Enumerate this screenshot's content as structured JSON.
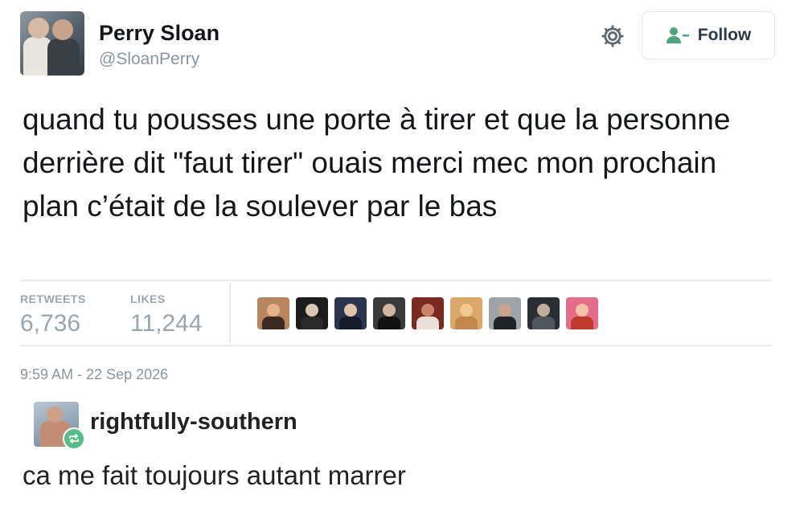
{
  "tweet": {
    "author_name": "Perry Sloan",
    "author_handle": "@SloanPerry",
    "follow_label": "Follow",
    "text": "quand tu pousses une porte à tirer et que la personne derrière dit \"faut tirer\" ouais merci mec mon prochain plan c’était de la soulever par le bas",
    "retweets_label": "RETWEETS",
    "retweets_count": "6,736",
    "likes_label": "LIKES",
    "likes_count": "11,244",
    "timestamp": "9:59 AM - 22 Sep 2026",
    "likers": [
      {
        "bg": "#b9855c",
        "face": "#e3b48c",
        "body": "#3b2a22"
      },
      {
        "bg": "#1c1c1c",
        "face": "#d9c7b6",
        "body": "#2a2a2a"
      },
      {
        "bg": "#2a3550",
        "face": "#e0c3a8",
        "body": "#151b2b"
      },
      {
        "bg": "#3a3a3a",
        "face": "#d1b7a2",
        "body": "#111111"
      },
      {
        "bg": "#7a2a20",
        "face": "#c9836a",
        "body": "#e8e0d8"
      },
      {
        "bg": "#d9a86a",
        "face": "#f1c98e",
        "body": "#c2874b"
      },
      {
        "bg": "#9ea3a8",
        "face": "#caa48d",
        "body": "#1f2428"
      },
      {
        "bg": "#2b2f33",
        "face": "#bfae9c",
        "body": "#50565c"
      },
      {
        "bg": "#e46b8a",
        "face": "#f2c3a6",
        "body": "#c0392b"
      }
    ]
  },
  "reblog": {
    "username": "rightfully-southern",
    "comment": "ca me fait toujours autant marrer",
    "badge_color": "#56bc8a"
  },
  "icons": {
    "settings": "gear-icon",
    "follow": "follow-person-icon",
    "reblog": "reblog-icon"
  }
}
